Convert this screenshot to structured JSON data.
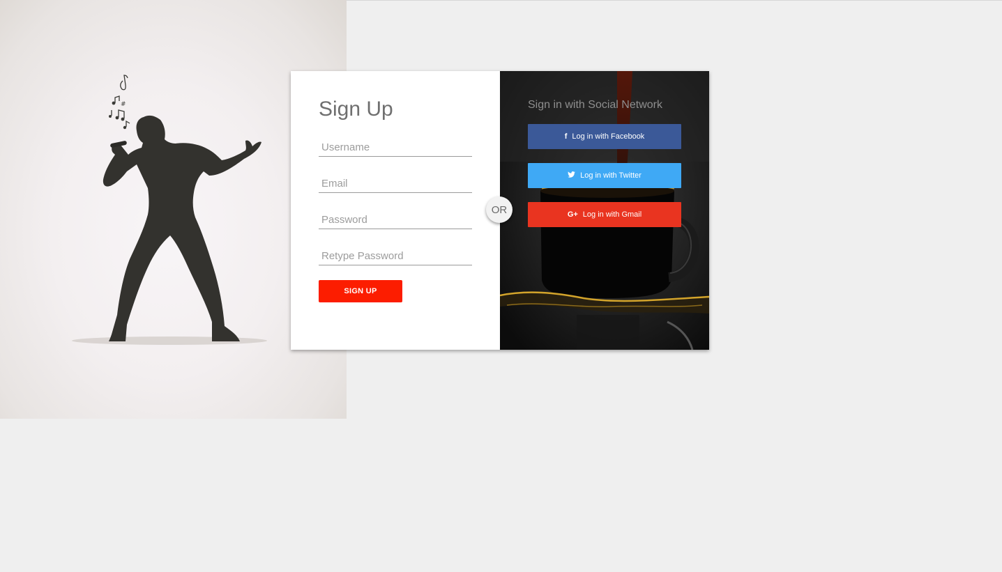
{
  "form": {
    "title": "Sign Up",
    "username_placeholder": "Username",
    "email_placeholder": "Email",
    "password_placeholder": "Password",
    "retype_placeholder": "Retype Password",
    "submit_label": "SIGN UP"
  },
  "divider": {
    "label": "OR"
  },
  "social": {
    "title": "Sign in with Social Network",
    "facebook": {
      "icon": "f",
      "label": "Log in with Facebook",
      "color": "#3b5998"
    },
    "twitter": {
      "icon": "🐦",
      "label": "Log in with Twitter",
      "color": "#3fa9f5"
    },
    "gmail": {
      "icon": "G+",
      "label": "Log in with Gmail",
      "color": "#e93420"
    }
  },
  "colors": {
    "accent": "#fc1d00",
    "page_background": "#efefef"
  }
}
